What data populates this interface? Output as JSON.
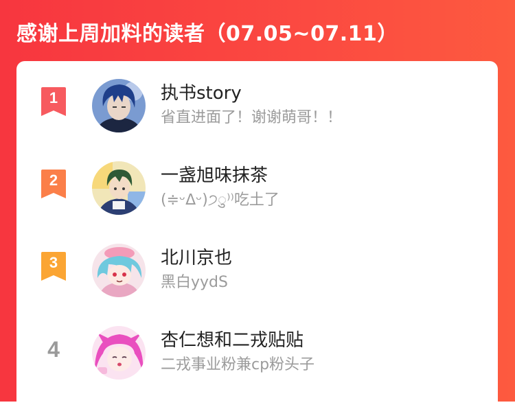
{
  "banner": {
    "title": "感谢上周加料的读者（07.05~07.11）",
    "background_color": "#f7363f"
  },
  "readers": [
    {
      "rank": "1",
      "rank_style": "ribbon",
      "rank_color": "#f75a5f",
      "name": "执书story",
      "message": "省直进面了！谢谢萌哥！！",
      "avatar_icon": "blue-hair-anime-avatar-icon"
    },
    {
      "rank": "2",
      "rank_style": "ribbon",
      "rank_color": "#fb7f49",
      "name": "一盏旭味抹茶",
      "message": "(≑ᵕᐃᵕ)੭ु⁾⁾吃土了",
      "avatar_icon": "green-hair-anime-avatar-icon"
    },
    {
      "rank": "3",
      "rank_style": "ribbon",
      "rank_color": "#fba533",
      "name": "北川京也",
      "message": "黑白yydS",
      "avatar_icon": "cyan-hair-anime-avatar-icon"
    },
    {
      "rank": "4",
      "rank_style": "plain",
      "rank_color": "#9a9a9a",
      "name": "杏仁想和二戎贴贴",
      "message": "二戎事业粉兼cp粉头子",
      "avatar_icon": "pink-hair-anime-avatar-icon"
    }
  ]
}
